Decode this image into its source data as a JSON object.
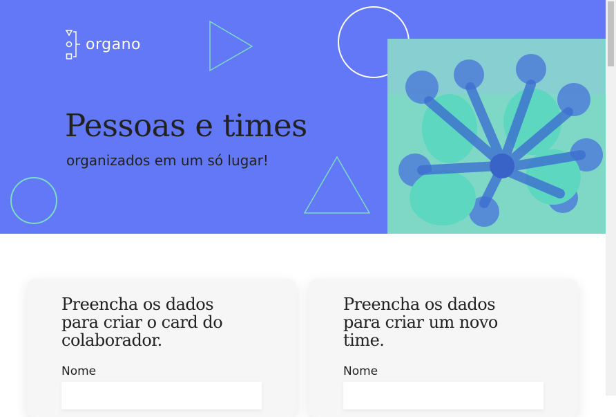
{
  "brand": {
    "name": "organo",
    "color": "#6278f7",
    "accent": "#7cdcc4"
  },
  "hero": {
    "title": "Pessoas e times",
    "subtitle": "organizados em um só lugar!"
  },
  "forms": [
    {
      "heading": "Preencha os dados para criar o card do colaborador.",
      "field_label": "Nome",
      "field_value": ""
    },
    {
      "heading": "Preencha os dados para criar um novo time.",
      "field_label": "Nome",
      "field_value": ""
    }
  ],
  "icons": {
    "logo": "organo-logo-icon",
    "triangle_right": "triangle-outline-icon",
    "triangle_up": "triangle-outline-icon",
    "circle": "circle-outline-icon"
  }
}
